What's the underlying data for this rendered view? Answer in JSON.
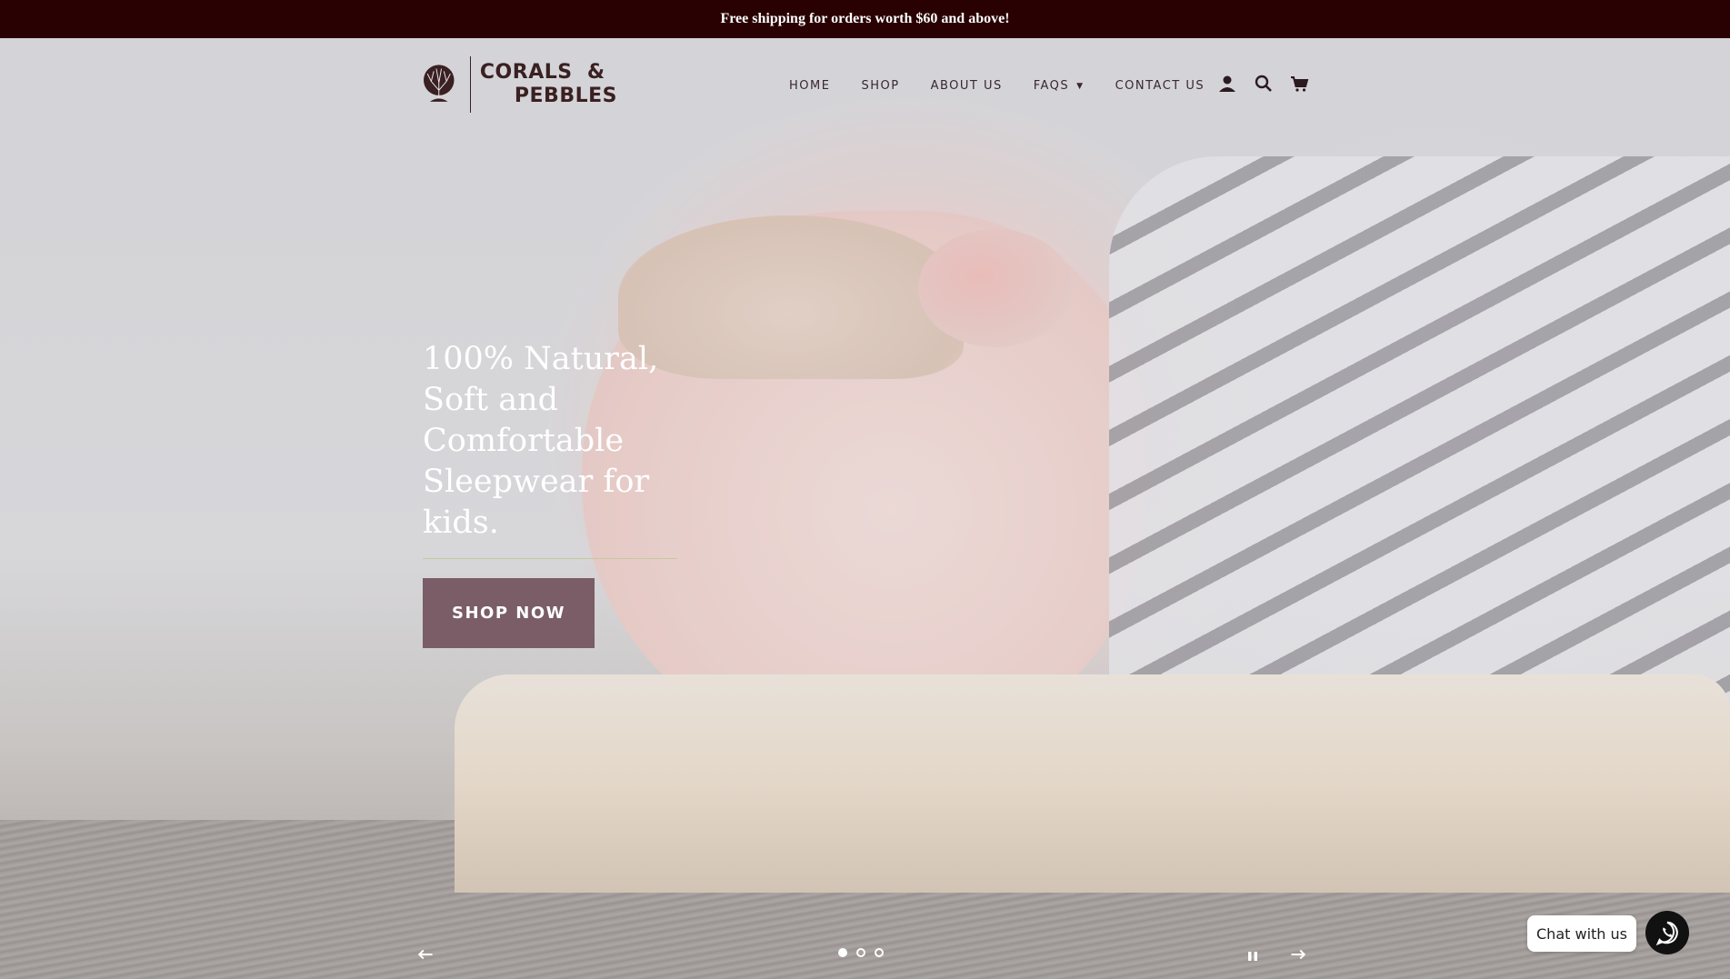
{
  "announcement": {
    "text": "Free shipping for orders worth $60 and above!"
  },
  "brand": {
    "name_line1": "CORALS  &",
    "name_line2": "PEBBLES"
  },
  "nav": {
    "items": [
      {
        "label": "HOME"
      },
      {
        "label": "SHOP"
      },
      {
        "label": "ABOUT US"
      },
      {
        "label": "FAQS"
      },
      {
        "label": "CONTACT US"
      }
    ],
    "icons": [
      "account-icon",
      "search-icon",
      "cart-icon"
    ]
  },
  "hero": {
    "headline": "100% Natural, Soft and Comfortable Sleepwear for kids.",
    "cta_label": "SHOP NOW",
    "slide_count": 3,
    "active_slide": 1
  },
  "chat": {
    "label": "Chat with us",
    "icon": "whatsapp-icon"
  },
  "colors": {
    "announcement_bg": "#2a0102",
    "brand_text": "#3a2022",
    "cta_bg": "#7a5d66",
    "nav_text": "#3a2630"
  }
}
